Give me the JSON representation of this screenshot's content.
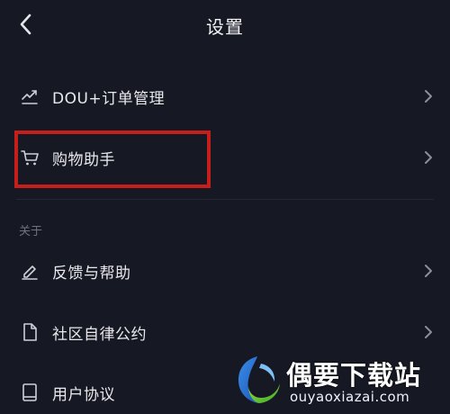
{
  "header": {
    "title": "设置",
    "back_icon": "chevron-left-icon"
  },
  "items_top": [
    {
      "label": "DOU+订单管理",
      "icon": "trend-chart-icon"
    },
    {
      "label": "购物助手",
      "icon": "shopping-cart-icon",
      "highlighted": true
    }
  ],
  "section_about": {
    "header": "关于",
    "items": [
      {
        "label": "反馈与帮助",
        "icon": "pencil-icon"
      },
      {
        "label": "社区自律公约",
        "icon": "document-icon"
      },
      {
        "label": "用户协议",
        "icon": "book-icon"
      }
    ]
  },
  "watermark": {
    "brand": "偶要下载站",
    "domain": "ouyaoxiazai.com"
  },
  "colors": {
    "background": "#161823",
    "highlight": "#c61f1b",
    "text": "#e9e9ec",
    "muted": "#6f7180"
  }
}
